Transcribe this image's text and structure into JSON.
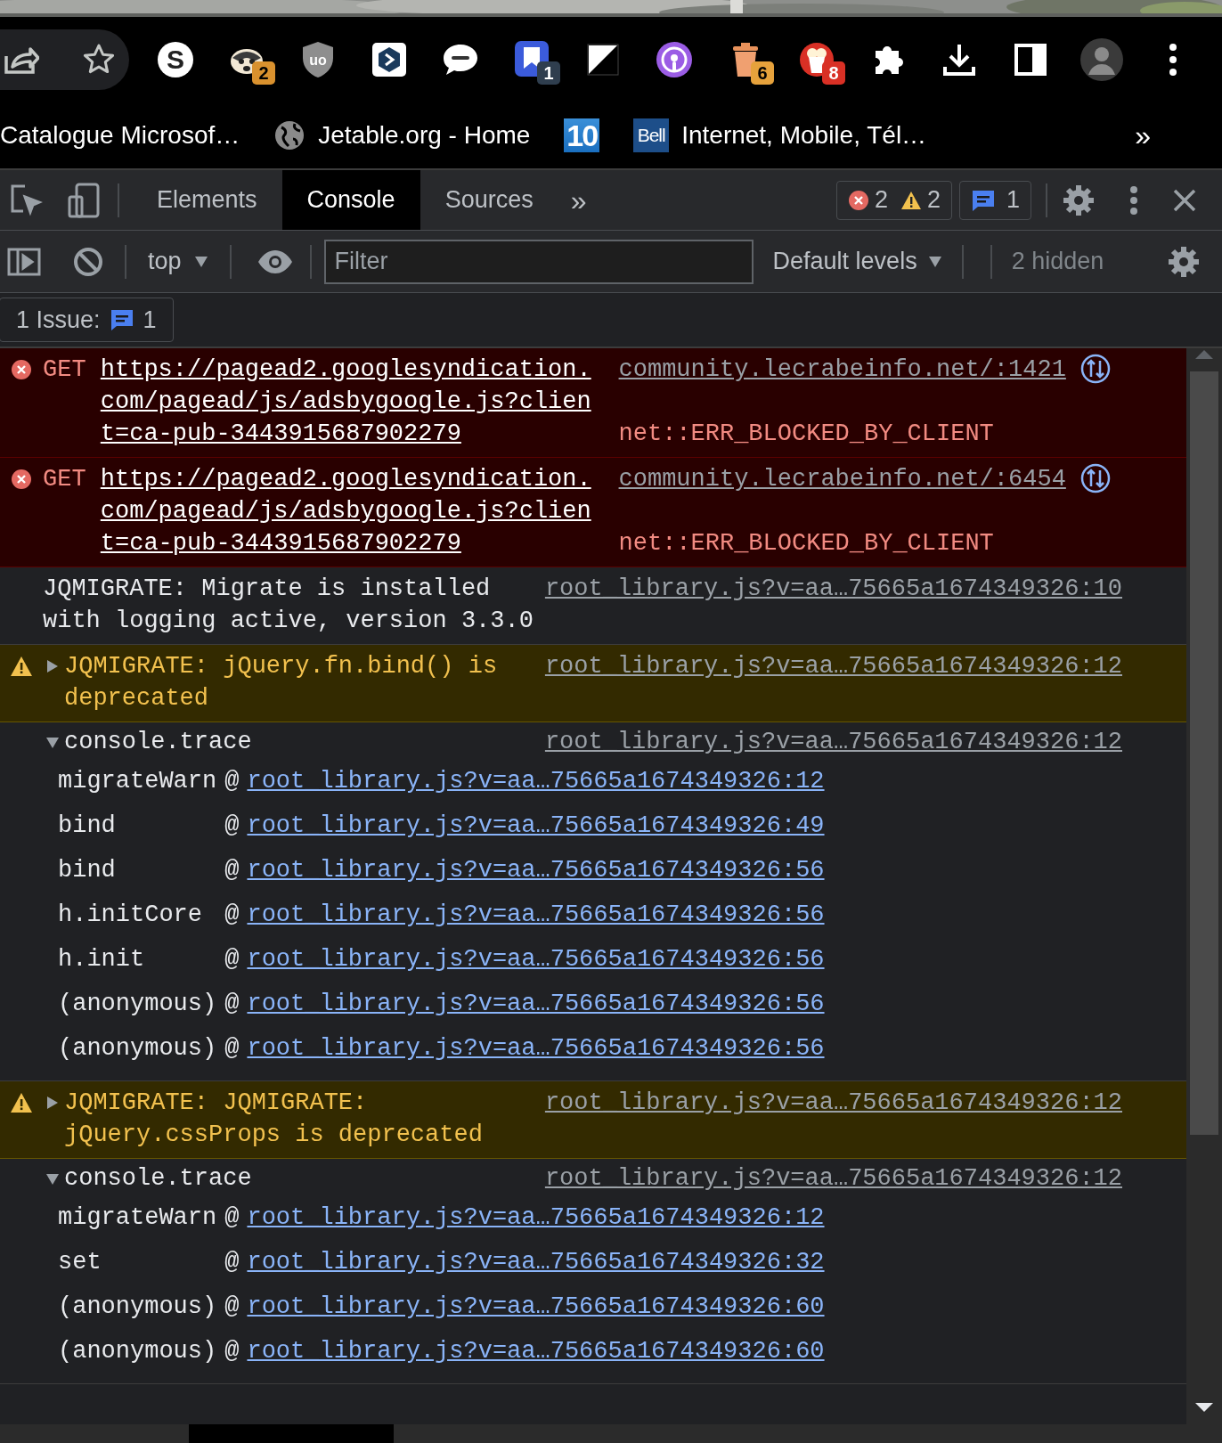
{
  "toolbar": {
    "extensions": [
      {
        "kind": "sphere",
        "icon_text": "S"
      },
      {
        "kind": "badger",
        "badge": {
          "text": "2",
          "color": "#d9912e"
        }
      },
      {
        "kind": "shield",
        "icon_text": "uo"
      },
      {
        "kind": "cube"
      },
      {
        "kind": "speech"
      },
      {
        "kind": "bookmark",
        "badge": {
          "text": "1",
          "color": "#2f3e4e"
        }
      },
      {
        "kind": "diagonal"
      },
      {
        "kind": "podcast"
      },
      {
        "kind": "trash",
        "badge": {
          "text": "6",
          "color": "#e6a23c"
        }
      },
      {
        "kind": "popcorn",
        "badge": {
          "text": "8",
          "color": "#d93025"
        }
      },
      {
        "kind": "puzzle"
      },
      {
        "kind": "download"
      },
      {
        "kind": "sidepanel"
      },
      {
        "kind": "avatar"
      },
      {
        "kind": "kebab"
      }
    ]
  },
  "bookmarks": {
    "items": [
      {
        "label": "Catalogue Microsof…"
      },
      {
        "kind": "globe",
        "label": "Jetable.org - Home"
      },
      {
        "kind": "tiles",
        "icon_text": "10"
      },
      {
        "kind": "tile",
        "icon_text": "Bell",
        "label": "Internet, Mobile, Tél…"
      }
    ],
    "overflow": "»"
  },
  "devtools": {
    "tabs": [
      {
        "label": "Elements",
        "selected": false
      },
      {
        "label": "Console",
        "selected": true
      },
      {
        "label": "Sources",
        "selected": false
      }
    ],
    "more_tabs": "»",
    "counters": {
      "errors": "2",
      "warnings": "2",
      "issues": "1"
    },
    "context": "top",
    "filter": {
      "placeholder": "Filter"
    },
    "levels": "Default levels",
    "hidden": "2 hidden",
    "issues": {
      "label": "1 Issue:",
      "count": "1"
    }
  },
  "messages": [
    {
      "kind": "error",
      "method": "GET",
      "url": "https://pagead2.googlesyndication.com/pagead/js/adsbygoogle.js?client=ca-pub-3443915687902279",
      "status": "net::ERR_BLOCKED_BY_CLIENT",
      "source": "community.lecrabeinfo.net/:1421"
    },
    {
      "kind": "error",
      "method": "GET",
      "url": "https://pagead2.googlesyndication.com/pagead/js/adsbygoogle.js?client=ca-pub-3443915687902279",
      "status": "net::ERR_BLOCKED_BY_CLIENT",
      "source": "community.lecrabeinfo.net/:6454"
    },
    {
      "kind": "info",
      "text": "JQMIGRATE: Migrate is installed with logging active, version 3.3.0",
      "source": "root_library.js?v=aa…75665a1674349326:10"
    },
    {
      "kind": "warning",
      "expanded": false,
      "text": "JQMIGRATE: jQuery.fn.bind() is deprecated",
      "source": "root_library.js?v=aa…75665a1674349326:12"
    },
    {
      "kind": "trace",
      "expanded": true,
      "text": "console.trace",
      "source": "root_library.js?v=aa…75665a1674349326:12",
      "frames": [
        {
          "function": "migrateWarn",
          "at": "@",
          "link": "root_library.js?v=aa…75665a1674349326:12"
        },
        {
          "function": "bind",
          "at": "@",
          "link": "root_library.js?v=aa…75665a1674349326:49"
        },
        {
          "function": "bind",
          "at": "@",
          "link": "root_library.js?v=aa…75665a1674349326:56"
        },
        {
          "function": "h.initCore",
          "at": "@",
          "link": "root_library.js?v=aa…75665a1674349326:56"
        },
        {
          "function": "h.init",
          "at": "@",
          "link": "root_library.js?v=aa…75665a1674349326:56"
        },
        {
          "function": "(anonymous)",
          "at": "@",
          "link": "root_library.js?v=aa…75665a1674349326:56"
        },
        {
          "function": "(anonymous)",
          "at": "@",
          "link": "root_library.js?v=aa…75665a1674349326:56"
        }
      ]
    },
    {
      "kind": "warning",
      "expanded": false,
      "text": "JQMIGRATE: JQMIGRATE: jQuery.cssProps is deprecated",
      "source": "root_library.js?v=aa…75665a1674349326:12"
    },
    {
      "kind": "trace",
      "expanded": true,
      "text": "console.trace",
      "source": "root_library.js?v=aa…75665a1674349326:12",
      "frames": [
        {
          "function": "migrateWarn",
          "at": "@",
          "link": "root_library.js?v=aa…75665a1674349326:12"
        },
        {
          "function": "set",
          "at": "@",
          "link": "root_library.js?v=aa…75665a1674349326:32"
        },
        {
          "function": "(anonymous)",
          "at": "@",
          "link": "root_library.js?v=aa…75665a1674349326:60"
        },
        {
          "function": "(anonymous)",
          "at": "@",
          "link": "root_library.js?v=aa…75665a1674349326:60"
        }
      ]
    }
  ]
}
